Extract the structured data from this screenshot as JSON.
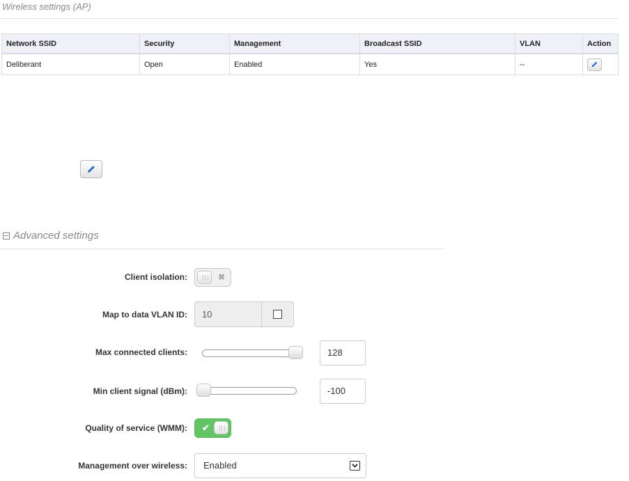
{
  "header": {
    "title": "Wireless settings (AP)"
  },
  "table": {
    "columns": [
      "Network SSID",
      "Security",
      "Management",
      "Broadcast SSID",
      "VLAN",
      "Action"
    ],
    "rows": [
      {
        "ssid": "Deliberant",
        "security": "Open",
        "management": "Enabled",
        "broadcast": "Yes",
        "vlan": "--"
      }
    ]
  },
  "advanced": {
    "title": "Advanced settings",
    "client_isolation": {
      "label": "Client isolation:",
      "enabled": false
    },
    "vlan_id": {
      "label": "Map to data VLAN ID:",
      "value": "10",
      "checked": false
    },
    "max_clients": {
      "label": "Max connected clients:",
      "value": "128",
      "slider_fraction": 1.0
    },
    "min_signal": {
      "label": "Min client signal (dBm):",
      "value": "-100",
      "slider_fraction": 0.0
    },
    "qos": {
      "label": "Quality of service (WMM):",
      "enabled": true
    },
    "mgmt_wireless": {
      "label": "Management over wireless:",
      "value": "Enabled"
    }
  },
  "icons": {
    "edit": "pencil-icon",
    "collapse": "minus-square-icon",
    "checkmark": "check-icon",
    "cross": "x-icon",
    "dropdown": "chevron-down-icon"
  },
  "colors": {
    "accent": "#2d6fd1",
    "toggle_on": "#62c462"
  }
}
